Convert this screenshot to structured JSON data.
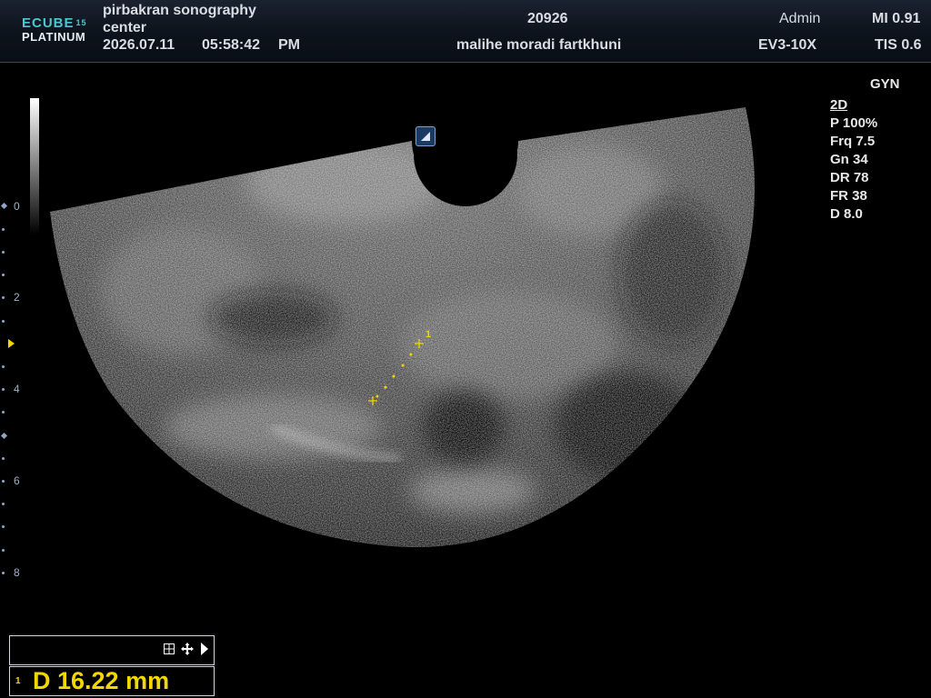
{
  "logo": {
    "line1": "ECUBE",
    "badge": "15",
    "line2": "PLATINUM"
  },
  "header": {
    "facility_line1": "pirbakran sonography",
    "facility_line2": "center",
    "date": "2026.07.11",
    "time": "05:58:42",
    "ampm": "PM",
    "patient_id": "20926",
    "patient_name": "malihe moradi fartkhuni",
    "user": "Admin",
    "probe": "EV3-10X",
    "mi": "MI 0.91",
    "tis": "TIS 0.6"
  },
  "preset": "GYN",
  "params": {
    "mode": "2D",
    "power": "P 100%",
    "frequency": "Frq 7.5",
    "gain": "Gn 34",
    "dynamic_range": "DR 78",
    "frame_rate": "FR 38",
    "depth": "D 8.0"
  },
  "depth_scale": {
    "labels": [
      "0",
      "2",
      "4",
      "6",
      "8"
    ]
  },
  "measurement": {
    "caliper_index": "1",
    "result_index": "1",
    "result": "D  16.22 mm"
  },
  "colors": {
    "caliper": "#f2d700",
    "accent": "#4cc6cf"
  }
}
